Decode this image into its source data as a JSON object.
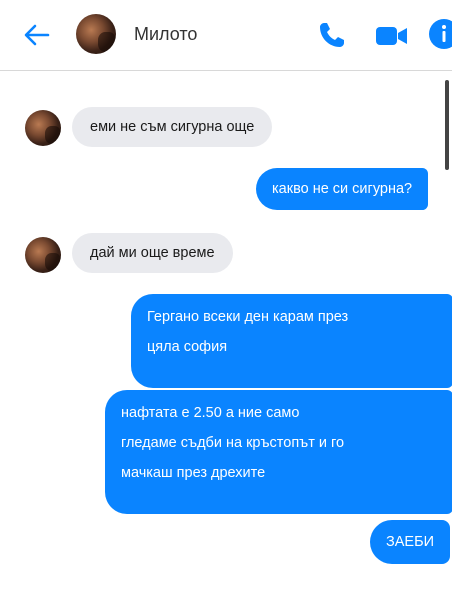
{
  "header": {
    "contact_name": "Милото",
    "accent_color": "#0a84ff",
    "icons": [
      "back-arrow-icon",
      "phone-icon",
      "video-camera-icon",
      "info-icon"
    ]
  },
  "messages": [
    {
      "direction": "incoming",
      "text": "еми не съм сигурна още"
    },
    {
      "direction": "outgoing",
      "text": "какво не си сигурна?"
    },
    {
      "direction": "incoming",
      "text": "дай ми още време"
    },
    {
      "direction": "outgoing",
      "lines": [
        "Гергано всеки ден карам през",
        "цяла софия"
      ]
    },
    {
      "direction": "outgoing",
      "lines": [
        "нафтата е 2.50 а ние само",
        "гледаме съдби на кръстопът и го",
        "мачкаш през дрехите"
      ]
    },
    {
      "direction": "outgoing",
      "text": "ЗАЕБИ"
    }
  ]
}
